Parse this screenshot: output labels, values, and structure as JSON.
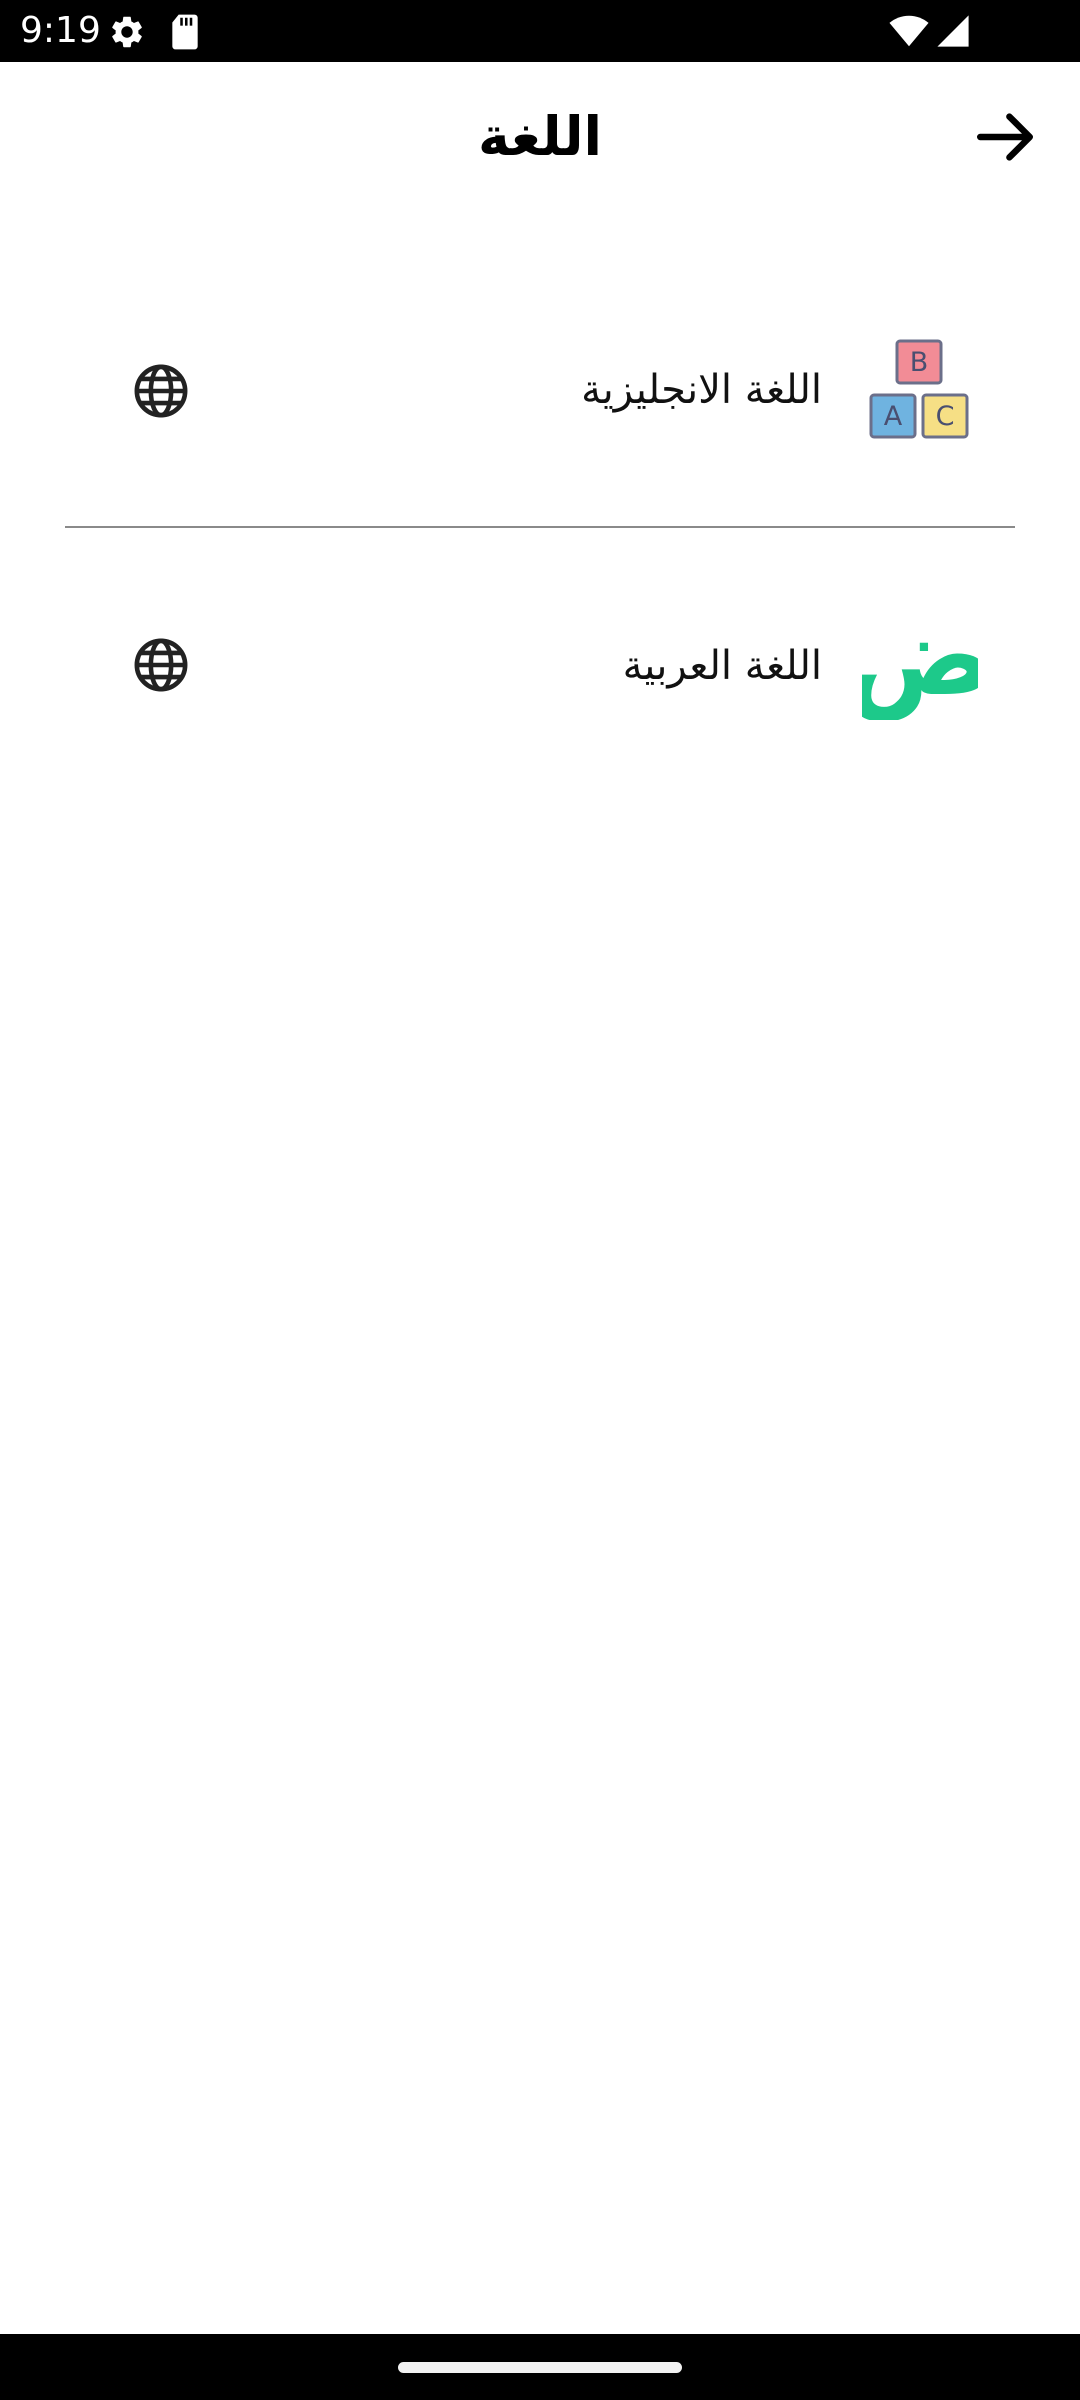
{
  "status_bar": {
    "time": "9:19",
    "icons": [
      "settings-icon",
      "sd-card-icon",
      "wifi-icon",
      "signal-icon"
    ]
  },
  "header": {
    "title": "اللغة",
    "back_icon": "arrow-right-icon"
  },
  "languages": [
    {
      "label": "اللغة الانجليزية",
      "picture_icon": "abc-blocks-icon",
      "picture_letters": [
        "B",
        "A",
        "C"
      ],
      "action_icon": "globe-icon"
    },
    {
      "label": "اللغة العربية",
      "picture_icon": "arabic-letter-icon",
      "picture_letter": "ض",
      "action_icon": "globe-icon"
    }
  ],
  "colors": {
    "arabic_letter": "#1dc98a",
    "block_b": "#f28c96",
    "block_a": "#6fb3e0",
    "block_c": "#f6df85",
    "block_outline": "#6b6f8a",
    "divider": "#8a8a8a"
  }
}
